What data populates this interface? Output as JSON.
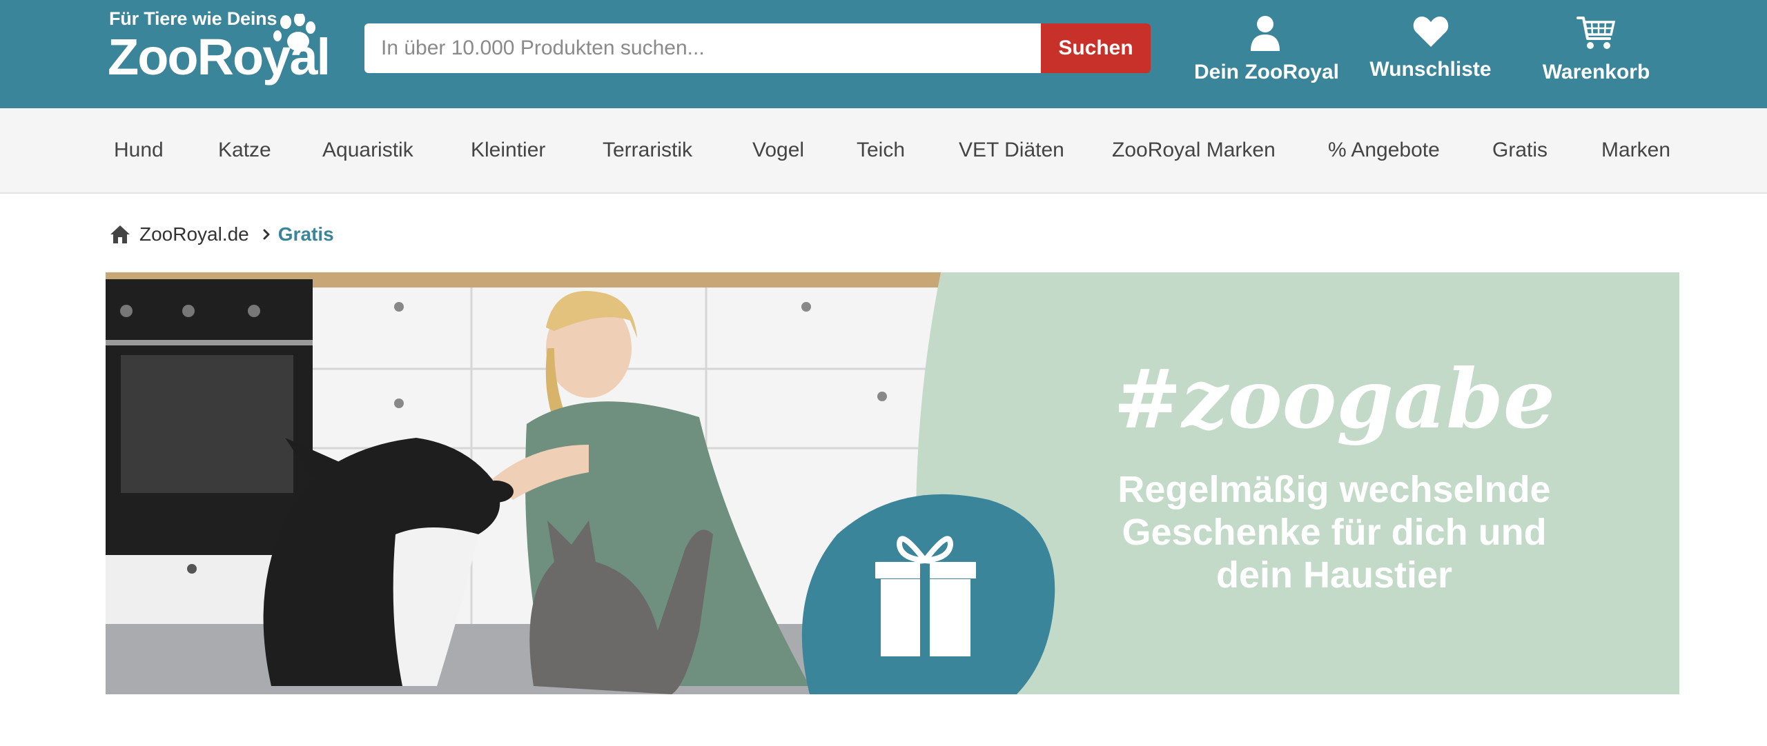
{
  "header": {
    "tagline": "Für Tiere wie Deins",
    "brand": "ZooRoyal",
    "colors": {
      "header_bg": "#3a8599",
      "search_button": "#c8302a",
      "accent_text": "#3a8599"
    }
  },
  "search": {
    "placeholder": "In über 10.000 Produkten suchen...",
    "value": "",
    "button_label": "Suchen"
  },
  "actions": [
    {
      "label": "Dein ZooRoyal",
      "icon": "user-icon"
    },
    {
      "label": "Wunschliste",
      "icon": "heart-icon"
    },
    {
      "label": "Warenkorb",
      "icon": "cart-icon"
    }
  ],
  "nav": {
    "items": [
      "Hund",
      "Katze",
      "Aquaristik",
      "Kleintier",
      "Terraristik",
      "Vogel",
      "Teich",
      "VET Diäten",
      "ZooRoyal Marken",
      "% Angebote",
      "Gratis",
      "Marken"
    ]
  },
  "breadcrumb": {
    "home_icon": "home-icon",
    "root": "ZooRoyal.de",
    "current": "Gratis"
  },
  "banner": {
    "hashtag": "#zoogabe",
    "line1": "Regelmäßig wechselnde",
    "line2": "Geschenke für dich und",
    "line3": "dein Haustier",
    "icon": "gift-icon",
    "colors": {
      "panel": "#c3dac9",
      "blob": "#3a8599"
    }
  }
}
